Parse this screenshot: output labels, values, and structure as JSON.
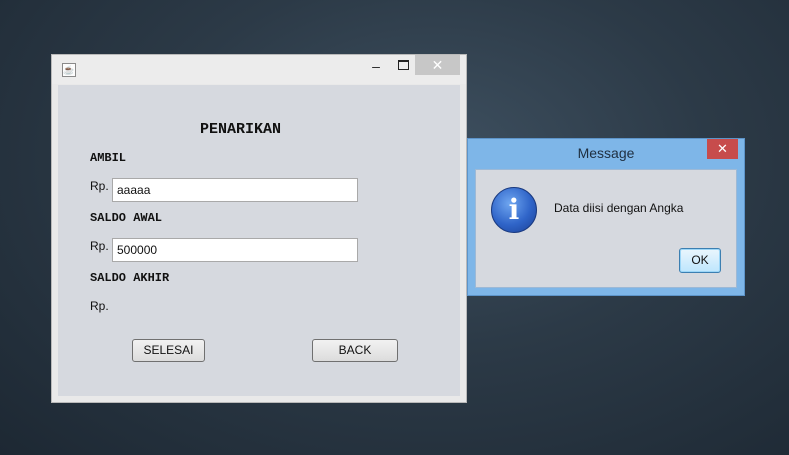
{
  "main_window": {
    "icon": "java-cup-icon",
    "controls": {
      "minimize": "–",
      "maximize": "□",
      "close": "✕"
    },
    "form": {
      "title": "PENARIKAN",
      "ambil_label": "AMBIL",
      "ambil_prefix": "Rp.",
      "ambil_value": "aaaaa",
      "saldo_awal_label": "SALDO AWAL",
      "saldo_awal_prefix": "Rp.",
      "saldo_awal_value": "500000",
      "saldo_akhir_label": "SALDO AKHIR",
      "saldo_akhir_prefix": "Rp.",
      "selesai_button": "SELESAI",
      "back_button": "BACK"
    }
  },
  "dialog": {
    "title": "Message",
    "close": "✕",
    "icon": "info-icon",
    "message": "Data diisi dengan Angka",
    "ok_button": "OK"
  }
}
